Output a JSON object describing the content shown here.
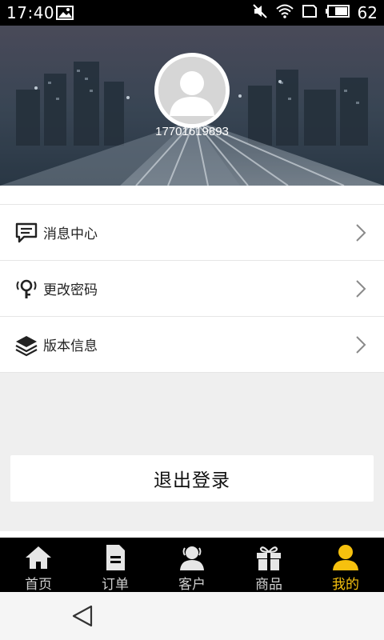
{
  "status_bar": {
    "time": "17:40",
    "battery": "62"
  },
  "profile": {
    "phone": "17701619893"
  },
  "menu": [
    {
      "label": "消息中心",
      "icon": "message-icon"
    },
    {
      "label": "更改密码",
      "icon": "key-icon"
    },
    {
      "label": "版本信息",
      "icon": "layers-icon"
    }
  ],
  "logout_label": "退出登录",
  "tabs": [
    {
      "label": "首页",
      "icon": "home-icon",
      "active": false
    },
    {
      "label": "订单",
      "icon": "document-icon",
      "active": false
    },
    {
      "label": "客户",
      "icon": "customers-icon",
      "active": false
    },
    {
      "label": "商品",
      "icon": "gift-icon",
      "active": false
    },
    {
      "label": "我的",
      "icon": "person-icon",
      "active": true
    }
  ],
  "colors": {
    "active_tab": "#f6c10e",
    "tabbar_bg": "#000000",
    "page_bg": "#efefef"
  }
}
